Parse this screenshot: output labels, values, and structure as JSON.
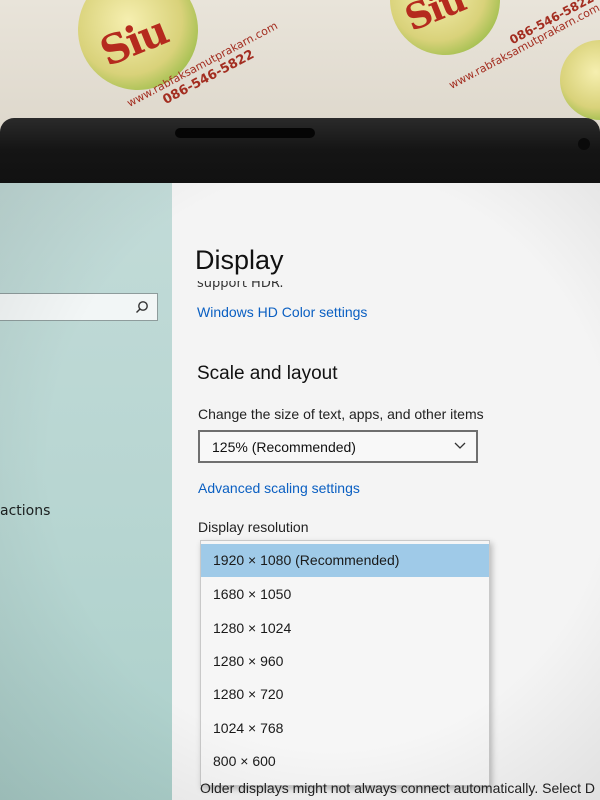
{
  "backdrop": {
    "sticker_brand": "Siu",
    "sticker_url": "www.rabfaksamutprakarn.com",
    "sticker_phone": "086-546-5822"
  },
  "sidebar": {
    "search_placeholder": "",
    "partial_item": "actions"
  },
  "settings": {
    "page_title": "Display",
    "clipped_text": "support HDR.",
    "hdr_link": "Windows HD Color settings",
    "scale_section_title": "Scale and layout",
    "scale_label": "Change the size of text, apps, and other items",
    "scale_value": "125% (Recommended)",
    "scaling_link": "Advanced scaling settings",
    "resolution_label": "Display resolution",
    "resolution_options": [
      "1920 × 1080 (Recommended)",
      "1680 × 1050",
      "1280 × 1024",
      "1280 × 960",
      "1280 × 720",
      "1024 × 768",
      "800 × 600"
    ],
    "selected_resolution_index": 0,
    "bottom_text": "Older displays might not always connect automatically. Select D"
  },
  "colors": {
    "accent_link": "#0a5fc2",
    "selected_option": "#9fcae8",
    "sidebar_bg": "#b8d6d2"
  }
}
